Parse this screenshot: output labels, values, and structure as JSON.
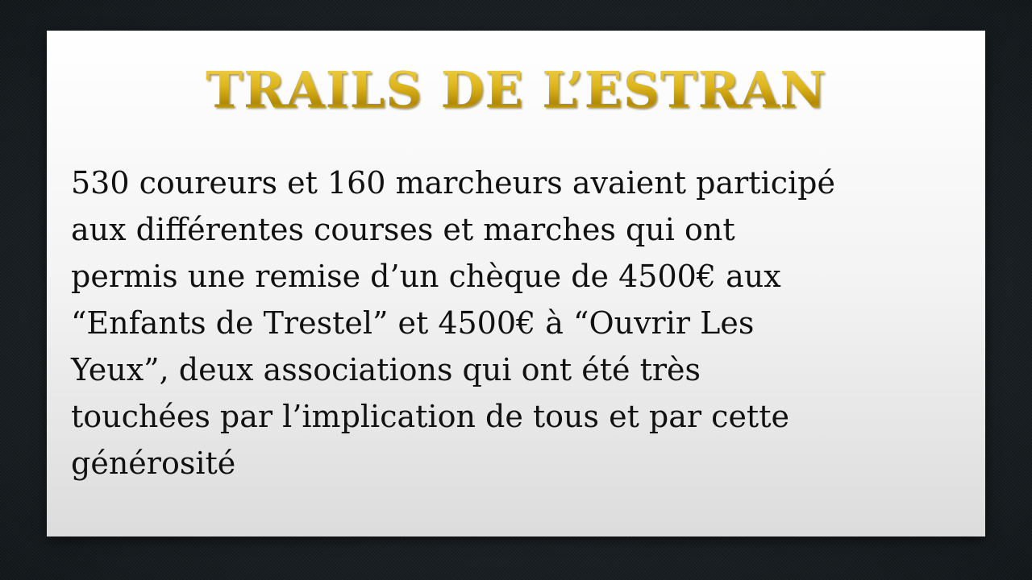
{
  "slide": {
    "title": "TRAILS DE L’ESTRAN",
    "lines": [
      "530 coureurs et 160 marcheurs avaient participé",
      "aux différentes courses et marches qui ont",
      "permis une remise d’un chèque de 4500€ aux",
      "“Enfants de Trestel” et 4500€ à “Ouvrir Les",
      "Yeux”, deux associations qui ont été très",
      "touchées par l’implication de tous et par cette",
      "générosité"
    ]
  },
  "colors": {
    "title_gold": "#c9a10e",
    "background": "#1c2226",
    "card": "#f3f3f3",
    "text": "#111111"
  }
}
